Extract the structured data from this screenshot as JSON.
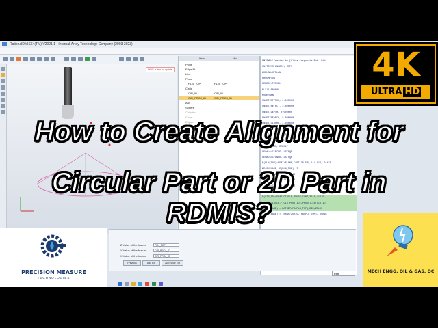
{
  "app": {
    "window_title": "RationalDMIS64(TM) V2021.1 - Internal-Array Technology Company (2003-2023)",
    "warning": "DMIS is dne for update"
  },
  "tree": {
    "col_item": "Item",
    "col_act": "Act",
    "items": [
      {
        "label": "Point"
      },
      {
        "label": "Edge Pt"
      },
      {
        "label": "Line"
      },
      {
        "label": "Plane"
      },
      {
        "label": "PLN_TOP",
        "act": "PLN_TOP"
      },
      {
        "label": "Circle"
      },
      {
        "label": "CIR_ID",
        "act": "CIR_ID"
      },
      {
        "label": "CIR_PROJ_ID",
        "act": "CIR_PROJ_ID"
      },
      {
        "label": "Arc"
      },
      {
        "label": "Sphere"
      },
      {
        "label": "Cylinder"
      },
      {
        "label": "Cone"
      },
      {
        "label": "Ellipse"
      },
      {
        "label": "Slot"
      },
      {
        "label": "Selected Point Cl..."
      }
    ]
  },
  "code": {
    "lines": [
      "DMISMN/'Created by [Ultra Corporate Pvt. Ltd.",
      "UNITS/MM,ANGDEC, MMPS",
      "WKPLAN/XYPLAN",
      "PRCOMP/ON",
      "FEDRAT/POSVEL",
      "FLY/1.000000",
      "MODE/MAN",
      "SNSET/APPRCH, 2.000000",
      "SNSET/RETRCT, 2.000000",
      "SNSET/DEPTH, 0.000000",
      "SNSET/SEARCH, 8.000000",
      "SNSET/CLRSRF, 4.000000",
      "RECALL/D(0)",
      "S(S_P)=SNSLCT/S(S1_D1)",
      "GEOALG/BF, LSTSQR",
      "GEOALG/ARC, DEFALT",
      "GEOALG/CIRCLE, LSTSQR",
      "GEOALG/CYLNDR, LSTSQR",
      "F(PLN_TOP)=FEAT/PLANE,CART,36.528,114.916,-0.478",
      "MEAS/PLANE, F(PLN_TOP), 3",
      "PTMEAS/CART, 1.25, 3.40",
      "PTMEAS/CART, 2.11, 0.98",
      "PTMEAS/CART, 0.44, 1.77",
      "ENDMES",
      "F(CIR_ID)=FEAT/CIRCLE,INNER,CART,36.5,114.9",
      "CONST/CIRCLE,F(CIR_PROJ_ID),PROJCT,FA(CIR_ID)",
      "D(CRD_BASE) = DATSET/FA(PLN_TOP),DIR,ZPLUS",
      "D(CRD_BASE) = TRANS/ZORIG, FA(PLN_TOP), XORIG"
    ]
  },
  "bottom": {
    "rows": [
      {
        "label": "Z Value of the feature",
        "value": "PLN_TOP"
      },
      {
        "label": "Y Value of the feature",
        "value": "CIR_PROJ_ID"
      },
      {
        "label": "X Value of the feature",
        "value": "CIR_PROJ_ID"
      }
    ],
    "buttons": [
      "Previous",
      "Add Ext",
      "Add Node Ext"
    ],
    "path_label": "Path"
  },
  "headline": {
    "line1": "How to Create Alignment for",
    "line2": "Circular Part or 2D Part in RDMIS?"
  },
  "badge": {
    "main": "4K",
    "sub_a": "ULTRA",
    "sub_b": "HD"
  },
  "brand_left": {
    "name": "PRECISION MEASURE",
    "sub": "TECHNOLOGIES"
  },
  "brand_right": {
    "name": "MECH ENGG. OIL & GAS, QC"
  },
  "colors": {
    "badge_gold": "#f2a900",
    "brand_blue": "#1d3a6e",
    "brand_yellow": "#fde04f"
  }
}
